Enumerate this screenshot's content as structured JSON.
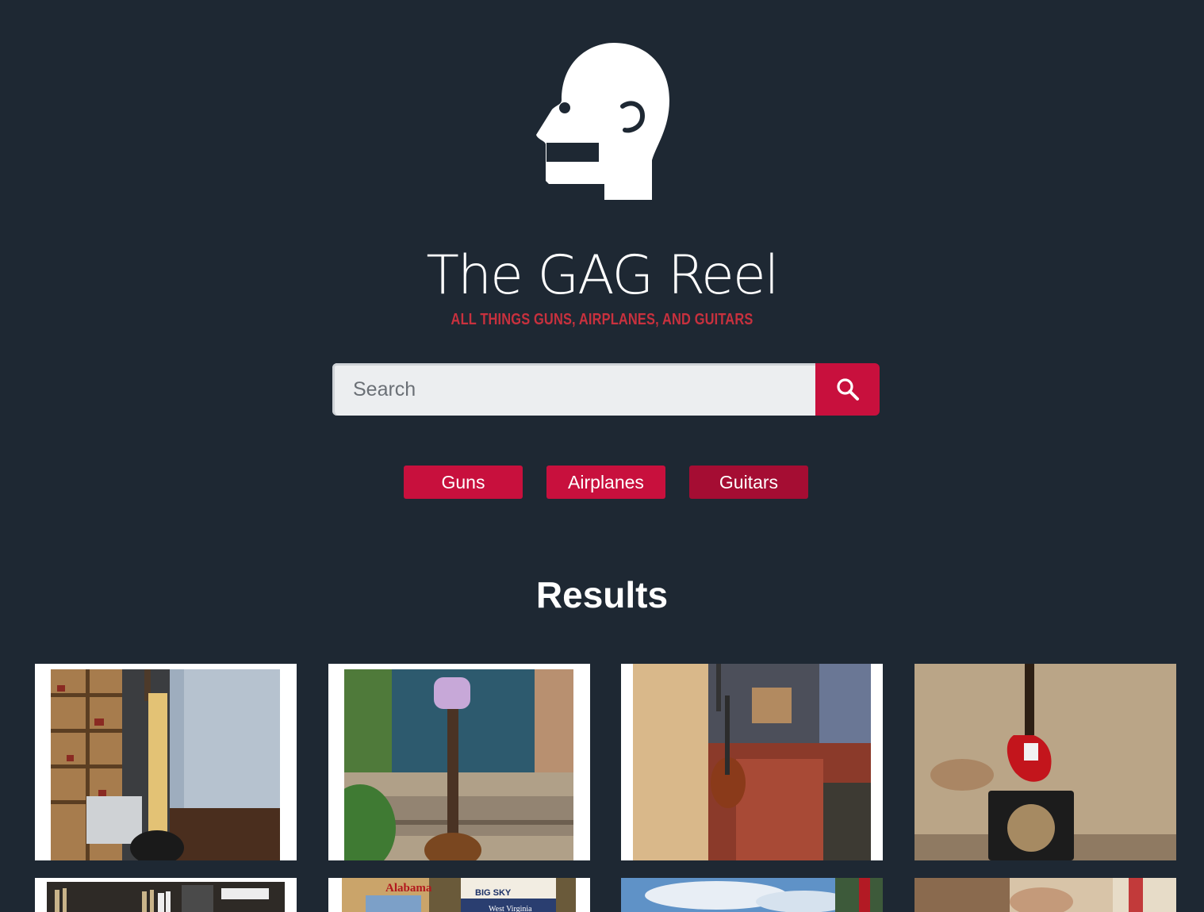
{
  "header": {
    "logo_icon": "bald-head-profile-icon",
    "title": "The GAG Reel",
    "tagline": "ALL THINGS GUNS, AIRPLANES, AND GUITARS"
  },
  "search": {
    "placeholder": "Search",
    "value": "",
    "button_icon": "search-icon"
  },
  "categories": [
    {
      "label": "Guns",
      "active": false
    },
    {
      "label": "Airplanes",
      "active": false
    },
    {
      "label": "Guitars",
      "active": true
    }
  ],
  "results": {
    "heading": "Results",
    "visible_sign_text": [
      "Alabama",
      "BIG SKY",
      "West Virginia"
    ]
  },
  "colors": {
    "background": "#1e2833",
    "accent": "#c8103d",
    "accent_active": "#a50d33",
    "tagline": "#c8313e",
    "search_field": "#eceef0"
  }
}
